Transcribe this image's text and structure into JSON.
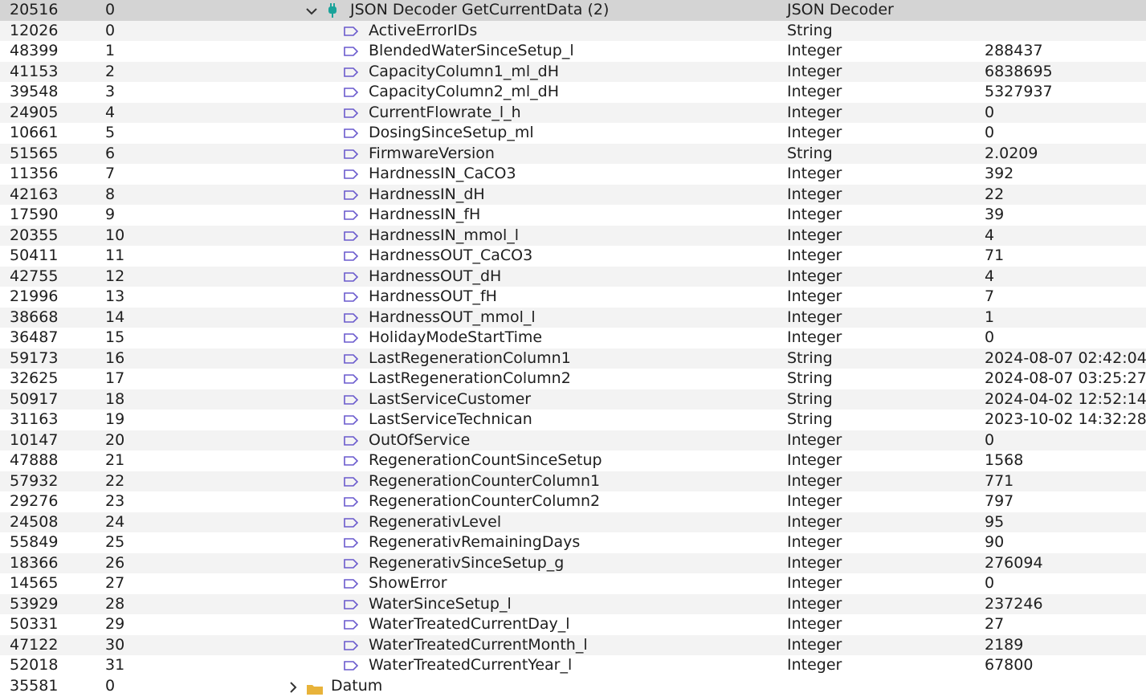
{
  "parent": {
    "id": "20516",
    "index": "0",
    "name": "JSON Decoder GetCurrentData (2)",
    "type": "JSON Decoder",
    "value": ""
  },
  "rows": [
    {
      "id": "12026",
      "index": "0",
      "name": "ActiveErrorIDs",
      "type": "String",
      "value": ""
    },
    {
      "id": "48399",
      "index": "1",
      "name": "BlendedWaterSinceSetup_l",
      "type": "Integer",
      "value": "288437"
    },
    {
      "id": "41153",
      "index": "2",
      "name": "CapacityColumn1_ml_dH",
      "type": "Integer",
      "value": "6838695"
    },
    {
      "id": "39548",
      "index": "3",
      "name": "CapacityColumn2_ml_dH",
      "type": "Integer",
      "value": "5327937"
    },
    {
      "id": "24905",
      "index": "4",
      "name": "CurrentFlowrate_l_h",
      "type": "Integer",
      "value": "0"
    },
    {
      "id": "10661",
      "index": "5",
      "name": "DosingSinceSetup_ml",
      "type": "Integer",
      "value": "0"
    },
    {
      "id": "51565",
      "index": "6",
      "name": "FirmwareVersion",
      "type": "String",
      "value": "2.0209"
    },
    {
      "id": "11356",
      "index": "7",
      "name": "HardnessIN_CaCO3",
      "type": "Integer",
      "value": "392"
    },
    {
      "id": "42163",
      "index": "8",
      "name": "HardnessIN_dH",
      "type": "Integer",
      "value": "22"
    },
    {
      "id": "17590",
      "index": "9",
      "name": "HardnessIN_fH",
      "type": "Integer",
      "value": "39"
    },
    {
      "id": "20355",
      "index": "10",
      "name": "HardnessIN_mmol_l",
      "type": "Integer",
      "value": "4"
    },
    {
      "id": "50411",
      "index": "11",
      "name": "HardnessOUT_CaCO3",
      "type": "Integer",
      "value": "71"
    },
    {
      "id": "42755",
      "index": "12",
      "name": "HardnessOUT_dH",
      "type": "Integer",
      "value": "4"
    },
    {
      "id": "21996",
      "index": "13",
      "name": "HardnessOUT_fH",
      "type": "Integer",
      "value": "7"
    },
    {
      "id": "38668",
      "index": "14",
      "name": "HardnessOUT_mmol_l",
      "type": "Integer",
      "value": "1"
    },
    {
      "id": "36487",
      "index": "15",
      "name": "HolidayModeStartTime",
      "type": "Integer",
      "value": "0"
    },
    {
      "id": "59173",
      "index": "16",
      "name": "LastRegenerationColumn1",
      "type": "String",
      "value": "2024-08-07 02:42:04"
    },
    {
      "id": "32625",
      "index": "17",
      "name": "LastRegenerationColumn2",
      "type": "String",
      "value": "2024-08-07 03:25:27"
    },
    {
      "id": "50917",
      "index": "18",
      "name": "LastServiceCustomer",
      "type": "String",
      "value": "2024-04-02 12:52:14"
    },
    {
      "id": "31163",
      "index": "19",
      "name": "LastServiceTechnican",
      "type": "String",
      "value": "2023-10-02 14:32:28"
    },
    {
      "id": "10147",
      "index": "20",
      "name": "OutOfService",
      "type": "Integer",
      "value": "0"
    },
    {
      "id": "47888",
      "index": "21",
      "name": "RegenerationCountSinceSetup",
      "type": "Integer",
      "value": "1568"
    },
    {
      "id": "57932",
      "index": "22",
      "name": "RegenerationCounterColumn1",
      "type": "Integer",
      "value": "771"
    },
    {
      "id": "29276",
      "index": "23",
      "name": "RegenerationCounterColumn2",
      "type": "Integer",
      "value": "797"
    },
    {
      "id": "24508",
      "index": "24",
      "name": "RegenerativLevel",
      "type": "Integer",
      "value": "95"
    },
    {
      "id": "55849",
      "index": "25",
      "name": "RegenerativRemainingDays",
      "type": "Integer",
      "value": "90"
    },
    {
      "id": "18366",
      "index": "26",
      "name": "RegenerativSinceSetup_g",
      "type": "Integer",
      "value": "276094"
    },
    {
      "id": "14565",
      "index": "27",
      "name": "ShowError",
      "type": "Integer",
      "value": "0"
    },
    {
      "id": "53929",
      "index": "28",
      "name": "WaterSinceSetup_l",
      "type": "Integer",
      "value": "237246"
    },
    {
      "id": "50331",
      "index": "29",
      "name": "WaterTreatedCurrentDay_l",
      "type": "Integer",
      "value": "27"
    },
    {
      "id": "47122",
      "index": "30",
      "name": "WaterTreatedCurrentMonth_l",
      "type": "Integer",
      "value": "2189"
    },
    {
      "id": "52018",
      "index": "31",
      "name": "WaterTreatedCurrentYear_l",
      "type": "Integer",
      "value": "67800"
    }
  ],
  "next": {
    "id": "35581",
    "index": "0",
    "name": "Datum"
  },
  "colors": {
    "selected_row": "#d4d4d4",
    "alt_row": "#f3f3f3",
    "tag_icon": "#6a5acd",
    "plug_icon": "#1aa39a",
    "folder_icon": "#e8b33a"
  },
  "icons": {
    "parent": "plug-icon",
    "child": "tag-icon",
    "next": "folder-icon"
  }
}
